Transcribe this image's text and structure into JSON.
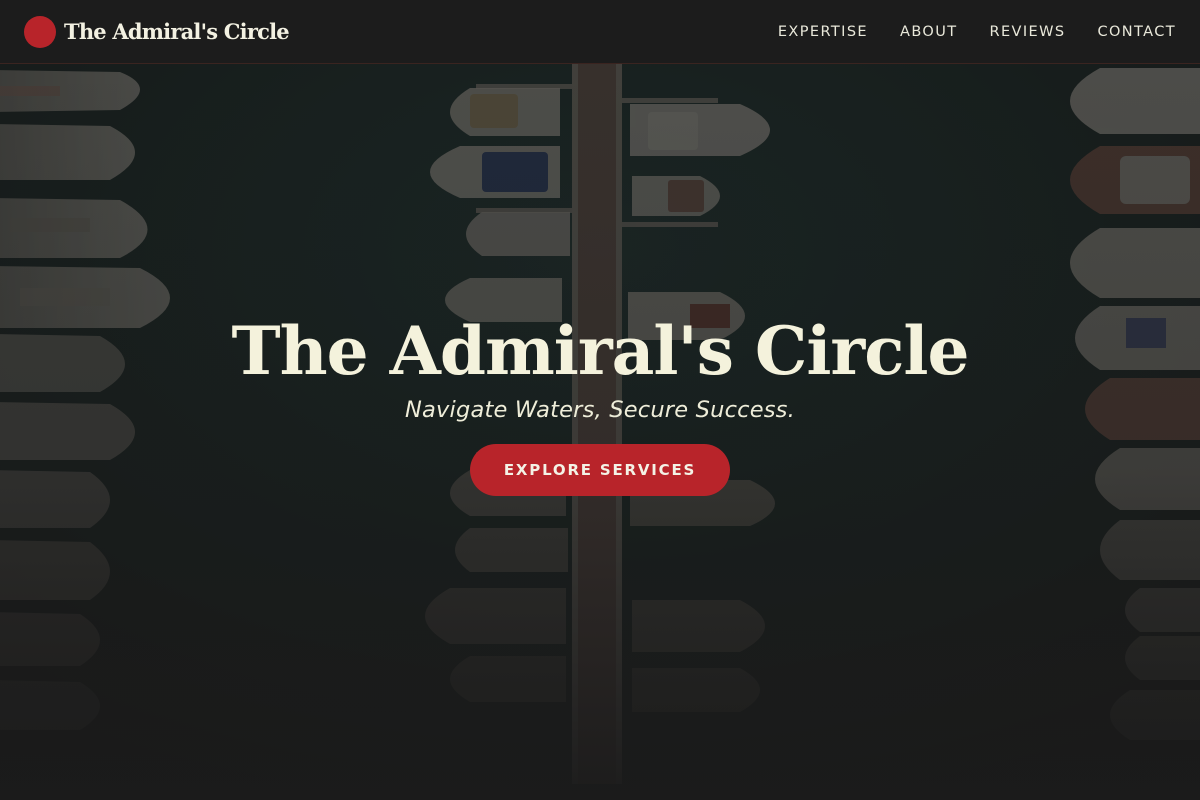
{
  "brand": {
    "name": "The Admiral's Circle"
  },
  "nav": {
    "items": [
      {
        "label": "EXPERTISE"
      },
      {
        "label": "ABOUT"
      },
      {
        "label": "REVIEWS"
      },
      {
        "label": "CONTACT"
      }
    ]
  },
  "hero": {
    "title": "The Admiral's Circle",
    "tagline": "Navigate Waters, Secure Success.",
    "cta_label": "EXPLORE SERVICES"
  },
  "colors": {
    "accent": "#b8242a",
    "navbar_bg": "#1c1c1c",
    "text_cream": "#f4f2dc"
  }
}
